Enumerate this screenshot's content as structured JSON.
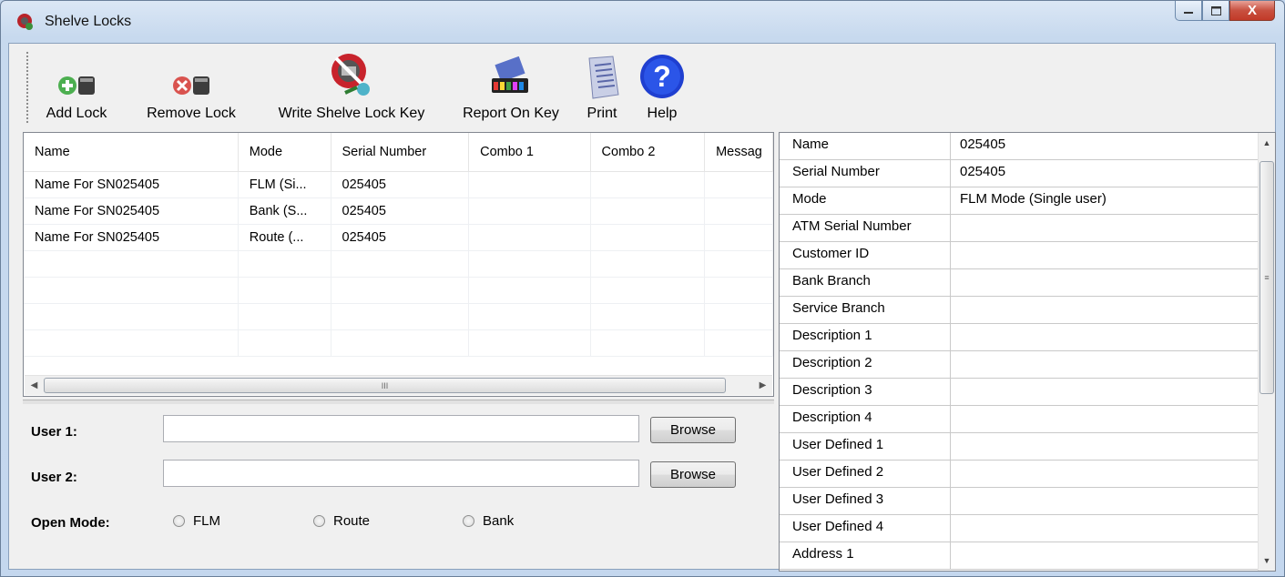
{
  "window": {
    "title": "Shelve Locks",
    "close_glyph": "X"
  },
  "toolbar": {
    "add_lock": "Add Lock",
    "remove_lock": "Remove Lock",
    "write_key": "Write Shelve Lock Key",
    "report_on_key": "Report On Key",
    "print": "Print",
    "help": "Help",
    "help_glyph": "?"
  },
  "locks_table": {
    "columns": [
      "Name",
      "Mode",
      "Serial Number",
      "Combo 1",
      "Combo 2",
      "Messag"
    ],
    "rows": [
      [
        "Name For SN025405",
        "FLM (Si...",
        "025405",
        "",
        "",
        ""
      ],
      [
        "Name For SN025405",
        "Bank (S...",
        "025405",
        "",
        "",
        ""
      ],
      [
        "Name For SN025405",
        "Route (...",
        "025405",
        "",
        "",
        ""
      ]
    ],
    "scroll_grip": "III"
  },
  "form": {
    "user1_label": "User 1:",
    "user1_value": "",
    "user2_label": "User 2:",
    "user2_value": "",
    "browse_label": "Browse",
    "open_mode_label": "Open Mode:",
    "modes": [
      "FLM",
      "Route",
      "Bank"
    ]
  },
  "properties": {
    "rows": [
      {
        "name": "Name",
        "value": "025405"
      },
      {
        "name": "Serial Number",
        "value": "025405"
      },
      {
        "name": "Mode",
        "value": "FLM Mode (Single user)"
      },
      {
        "name": "ATM Serial Number",
        "value": ""
      },
      {
        "name": "Customer ID",
        "value": ""
      },
      {
        "name": "Bank Branch",
        "value": ""
      },
      {
        "name": "Service Branch",
        "value": ""
      },
      {
        "name": "Description 1",
        "value": ""
      },
      {
        "name": "Description 2",
        "value": ""
      },
      {
        "name": "Description 3",
        "value": ""
      },
      {
        "name": "Description 4",
        "value": ""
      },
      {
        "name": "User Defined 1",
        "value": ""
      },
      {
        "name": "User Defined 2",
        "value": ""
      },
      {
        "name": "User Defined 3",
        "value": ""
      },
      {
        "name": "User Defined 4",
        "value": ""
      },
      {
        "name": "Address 1",
        "value": ""
      }
    ],
    "scroll_grip": "≡"
  },
  "colors": {
    "title_bar": "#c4d7ee",
    "close_button": "#c23a28",
    "help_icon": "#2244cc"
  }
}
